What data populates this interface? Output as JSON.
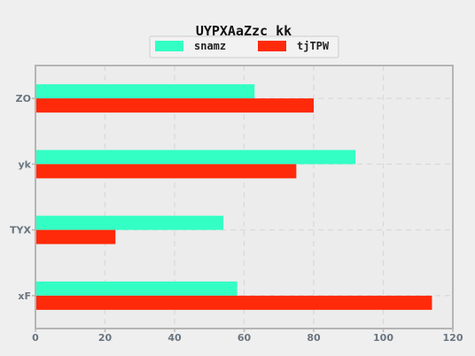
{
  "chart_data": {
    "type": "bar",
    "orientation": "horizontal",
    "title": "UYPXAaZzc kk",
    "xlabel": "",
    "ylabel": "",
    "categories": [
      "xF",
      "TYX",
      "yk",
      "ZO"
    ],
    "series": [
      {
        "name": "snamz",
        "color": "#33ffc4",
        "values": [
          58,
          54,
          92,
          63
        ]
      },
      {
        "name": "tjTPW",
        "color": "#ff2a0a",
        "values": [
          114,
          23,
          75,
          80
        ]
      }
    ],
    "xlim": [
      0,
      120
    ],
    "xticks": [
      "0",
      "20",
      "40",
      "60",
      "80",
      "100",
      "120"
    ],
    "grid": true,
    "legend_position": "top-center",
    "colors": {
      "background": "#efefef",
      "plot_background": "#ececec",
      "axis": "#b5b5b5",
      "grid": "#d9d9d9",
      "tick_text": "#6a7580"
    }
  }
}
